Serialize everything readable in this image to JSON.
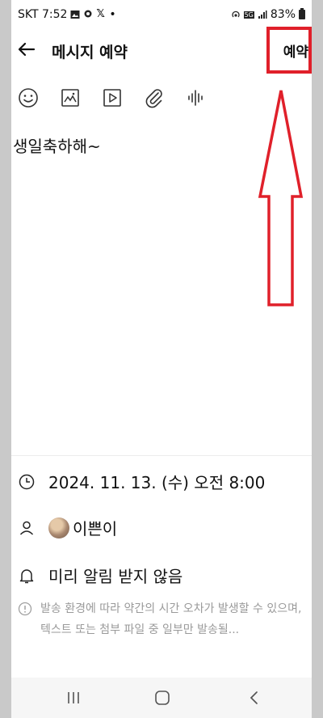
{
  "status_bar": {
    "carrier_time": "SKT 7:52",
    "dot": "•",
    "network": "5G",
    "battery": "83%"
  },
  "header": {
    "title": "메시지 예약",
    "reserve_label": "예약"
  },
  "toolbar": [
    "emoji-icon",
    "image-icon",
    "video-icon",
    "attach-icon",
    "voice-icon"
  ],
  "message": {
    "text": "생일축하해~"
  },
  "schedule": {
    "datetime": "2024. 11. 13. (수) 오전 8:00"
  },
  "recipient": {
    "name": "이쁜이"
  },
  "alert": {
    "text": "미리 알림 받지 않음"
  },
  "notice": {
    "text": "발송 환경에 따라 약간의 시간 오차가 발생할 수 있으며, 텍스트 또는 첨부 파일 중 일부만 발송될..."
  },
  "colors": {
    "annotation_red": "#e0202a"
  }
}
